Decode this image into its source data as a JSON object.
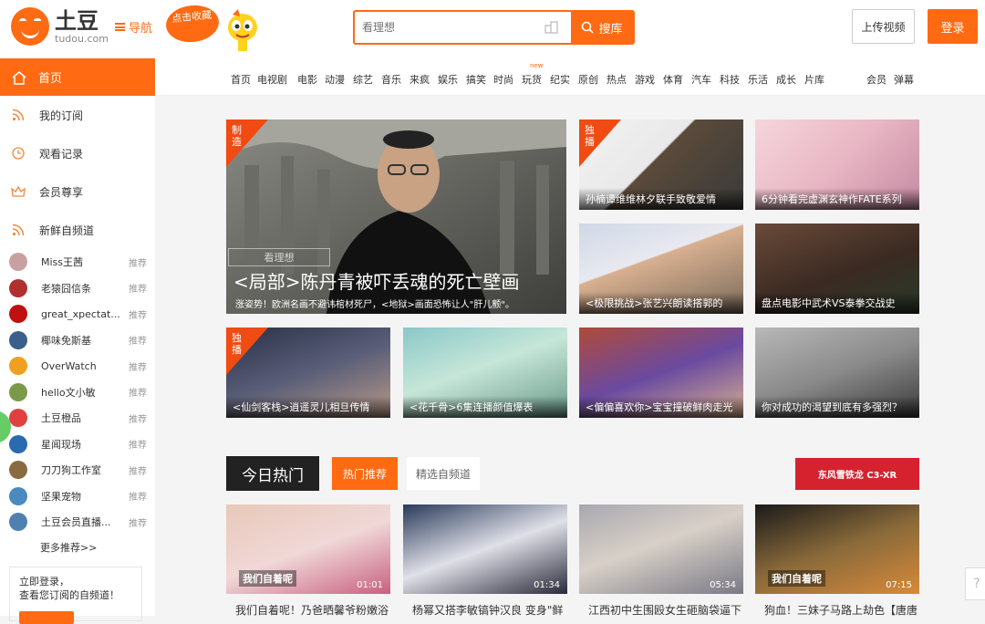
{
  "header": {
    "logo_cn": "土豆",
    "logo_en": "tudou.com",
    "nav_label": "导航",
    "fav_bubble": "点击收藏",
    "search_placeholder": "看理想",
    "search_button": "搜库",
    "upload_button": "上传视频",
    "login_button": "登录"
  },
  "sidebar": {
    "home": "首页",
    "items": [
      {
        "label": "我的订阅",
        "icon": "rss-icon"
      },
      {
        "label": "观看记录",
        "icon": "clock-icon"
      },
      {
        "label": "会员尊享",
        "icon": "crown-icon"
      },
      {
        "label": "新鲜自频道",
        "icon": "rss-icon"
      }
    ],
    "channels": [
      {
        "name": "Miss王茜",
        "rec": "推荐",
        "color": "#c9a0a0"
      },
      {
        "name": "老猿囧信条",
        "rec": "推荐",
        "color": "#b03030"
      },
      {
        "name": "great_xpectat...",
        "rec": "推荐",
        "color": "#c01010"
      },
      {
        "name": "椰味免斯基",
        "rec": "推荐",
        "color": "#3a5f8a"
      },
      {
        "name": "OverWatch",
        "rec": "推荐",
        "color": "#f0a020"
      },
      {
        "name": "hello文小敏",
        "rec": "推荐",
        "color": "#7a9a4a"
      },
      {
        "name": "土豆橙品",
        "rec": "推荐",
        "color": "#e04040"
      },
      {
        "name": "星闻现场",
        "rec": "推荐",
        "color": "#2a6ab0"
      },
      {
        "name": "刀刀狗工作室",
        "rec": "推荐",
        "color": "#8a6a40"
      },
      {
        "name": "坚果宠物",
        "rec": "推荐",
        "color": "#4a8ac0"
      },
      {
        "name": "土豆会员直播...",
        "rec": "推荐",
        "color": "#5080b0"
      }
    ],
    "more": "更多推荐>>",
    "login_tip_1": "立即登录，",
    "login_tip_2": "查看您订阅的自频道！"
  },
  "topnav": {
    "left": [
      "首页",
      "电视剧",
      "电影",
      "动漫",
      "综艺",
      "音乐",
      "来疯",
      "娱乐",
      "搞笑",
      "时尚",
      "玩货",
      "纪实",
      "原创",
      "热点",
      "游戏",
      "体育",
      "汽车",
      "科技",
      "乐活",
      "成长",
      "片库"
    ],
    "right": [
      "会员",
      "弹幕"
    ],
    "new_badge": "new"
  },
  "featured": {
    "hero": {
      "tag": "制造",
      "title": "<局部>陈丹青被吓丢魂的死亡壁画",
      "subtitle": "涨姿势！欧洲名画不避讳棺材死尸，<地狱>画面恐怖让人\"肝儿颤\"。",
      "watermark": "看理想"
    },
    "cards": [
      {
        "caption": "孙楠谭维维林夕联手致敬爱情",
        "tag": "独播"
      },
      {
        "caption": "6分钟看完虚渊玄神作FATE系列",
        "tag": ""
      },
      {
        "caption": "<极限挑战>张艺兴朗读搭郭的",
        "tag": ""
      },
      {
        "caption": "盘点电影中武术VS泰拳交战史",
        "tag": ""
      },
      {
        "caption": "<仙剑客栈>逍遥灵儿相旦传情",
        "tag": "独播"
      },
      {
        "caption": "<花千骨>6集连播颜值爆表",
        "tag": ""
      },
      {
        "caption": "<偏偏喜欢你>宝宝撞破鲜肉走光",
        "tag": ""
      },
      {
        "caption": "你对成功的渴望到底有多强烈？",
        "tag": ""
      }
    ]
  },
  "hot": {
    "title": "今日热门",
    "tab_active": "热门推荐",
    "tab_inactive": "精选自频道",
    "ad_text": "东风雪铁龙 C3-XR",
    "videos": [
      {
        "title": "我们自着呢！乃爸晒馨爷粉嫩浴",
        "duration": "01:01",
        "overlay": "我们自着呢"
      },
      {
        "title": "杨幂又搭李敏镐钟汉良 变身\"鲜",
        "duration": "01:34",
        "overlay": ""
      },
      {
        "title": "江西初中生围殴女生砸脑袋逼下",
        "duration": "05:34",
        "overlay": ""
      },
      {
        "title": "狗血！三妹子马路上劫色【唐唐",
        "duration": "07:15",
        "overlay": "我们自着呢"
      }
    ]
  },
  "help_label": "?"
}
